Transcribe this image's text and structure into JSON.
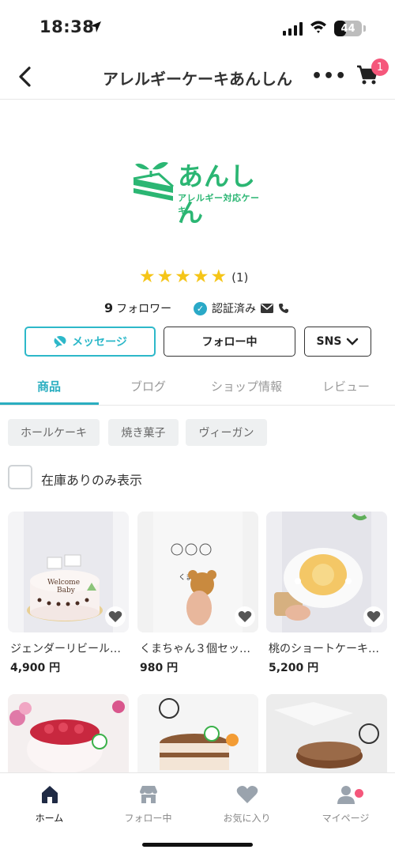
{
  "status": {
    "time": "18:38",
    "battery": "44",
    "battery_level": 0.44
  },
  "nav": {
    "title": "アレルギーケーキあんしん",
    "more": "•••",
    "cart_badge": "1"
  },
  "shop": {
    "logo_main": "あんしん",
    "logo_sub": "アレルギー対応ケーキ",
    "rating_stars": 5,
    "rating_count": "(1)",
    "followers_count": "9",
    "followers_label": "フォロワー",
    "verified_label": "認証済み"
  },
  "actions": {
    "message": "メッセージ",
    "follow": "フォロー中",
    "sns": "SNS"
  },
  "tabs": [
    {
      "label": "商品",
      "active": true
    },
    {
      "label": "ブログ",
      "active": false
    },
    {
      "label": "ショップ情報",
      "active": false
    },
    {
      "label": "レビュー",
      "active": false
    }
  ],
  "categories": [
    "ホールケーキ",
    "焼き菓子",
    "ヴィーガン"
  ],
  "stock_filter": {
    "label": "在庫ありのみ表示",
    "checked": false
  },
  "products": [
    {
      "name": "ジェンダーリビール…",
      "price": "4,900 円"
    },
    {
      "name": "くまちゃん３個セッ…",
      "price": "980 円"
    },
    {
      "name": "桃のショートケーキ…",
      "price": "5,200 円"
    },
    {
      "name": "",
      "price": ""
    },
    {
      "name": "",
      "price": ""
    },
    {
      "name": "",
      "price": ""
    }
  ],
  "bottom_tabs": [
    {
      "label": "ホーム",
      "icon": "home-icon",
      "active": true
    },
    {
      "label": "フォロー中",
      "icon": "store-icon",
      "active": false
    },
    {
      "label": "お気に入り",
      "icon": "heart-icon",
      "active": false
    },
    {
      "label": "マイページ",
      "icon": "person-icon",
      "active": false
    }
  ],
  "colors": {
    "accent": "#2aaec0",
    "brand_green": "#2bb673",
    "badge": "#f5577b",
    "star": "#f5c518"
  }
}
